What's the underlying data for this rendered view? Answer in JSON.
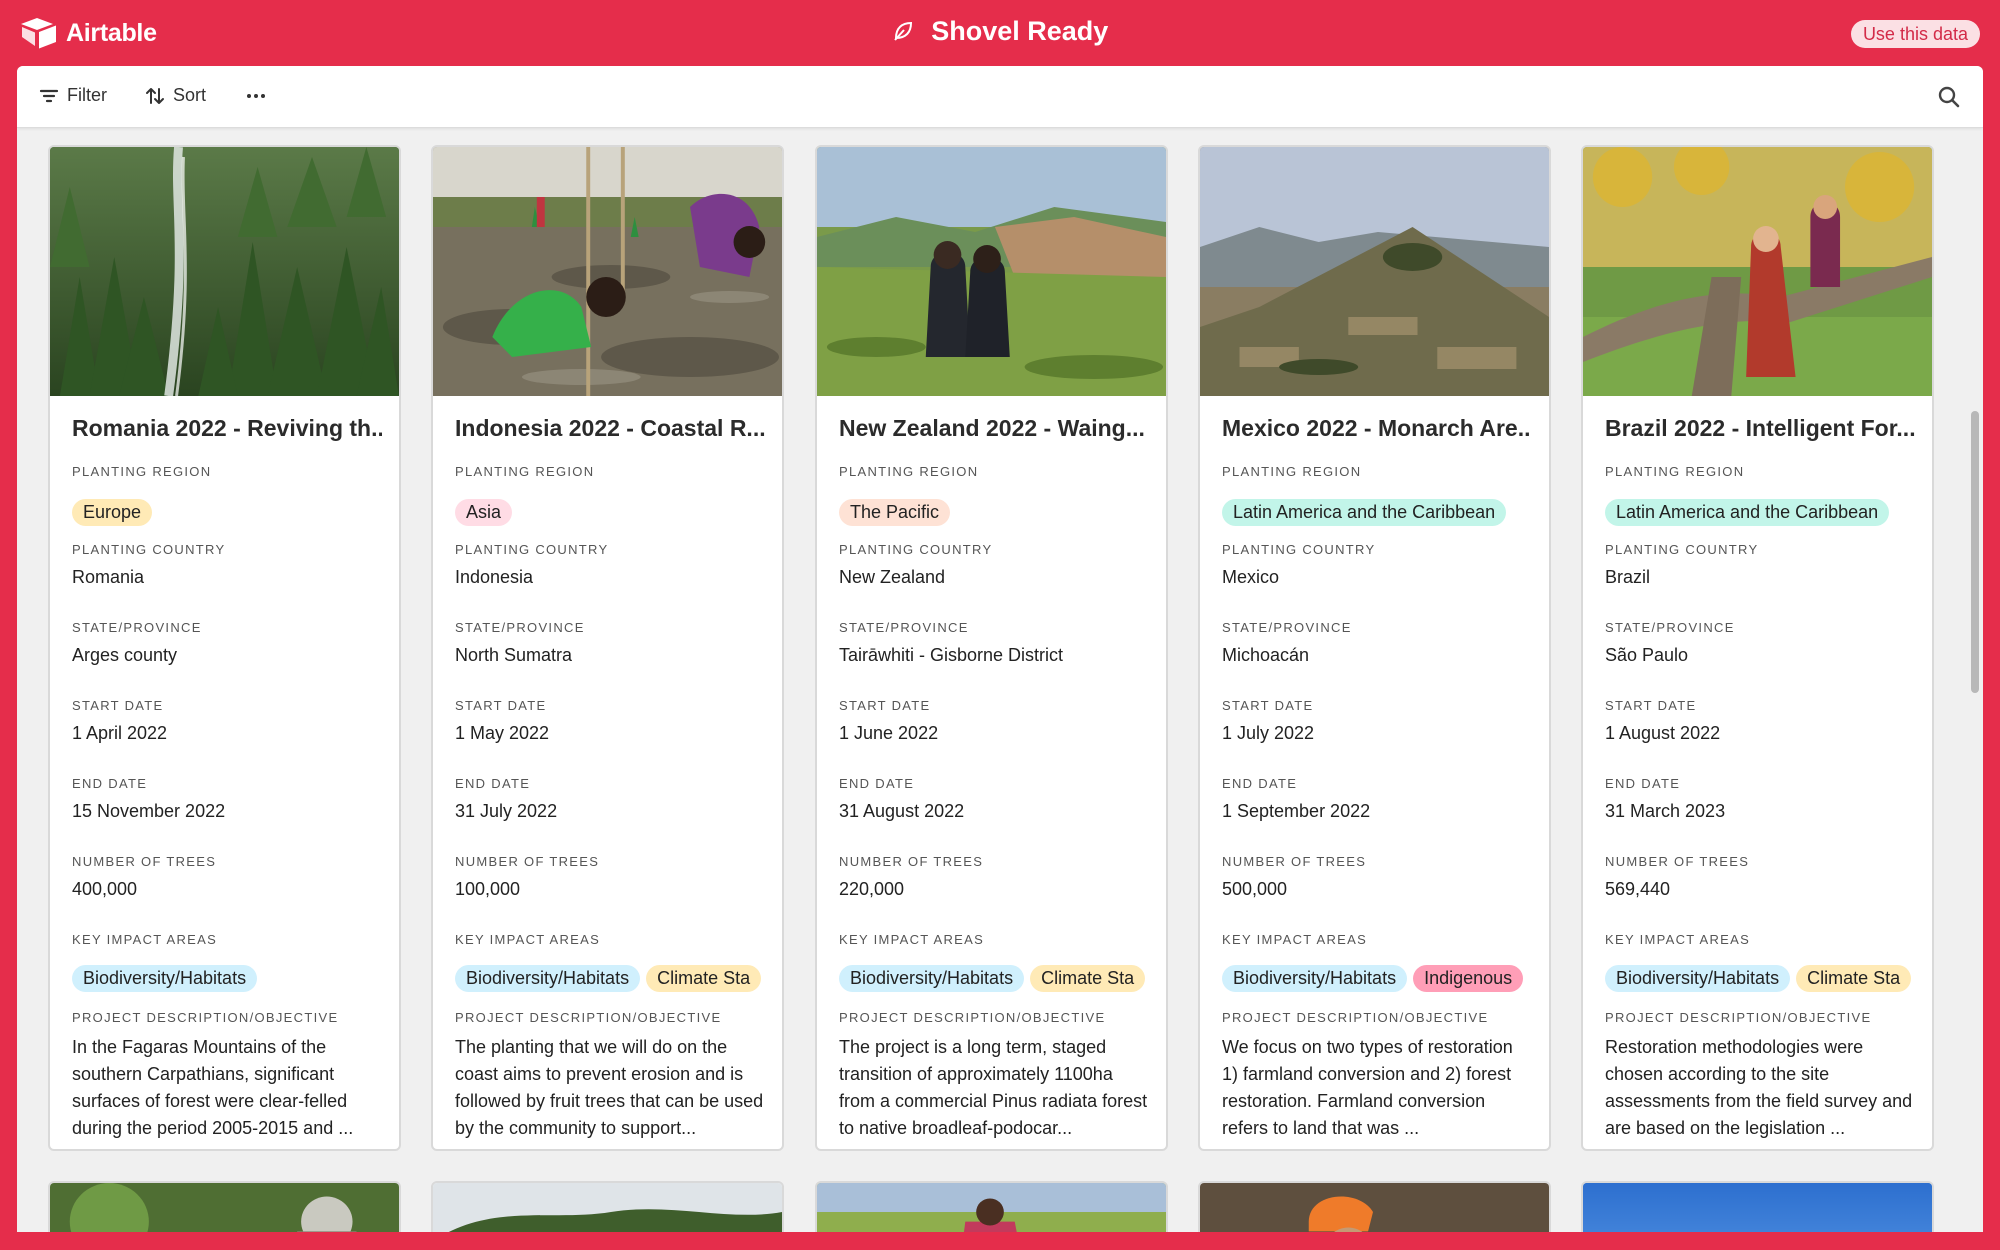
{
  "app": {
    "name": "Airtable",
    "base_title": "Shovel Ready",
    "use_data_label": "Use this data"
  },
  "toolbar": {
    "filter_label": "Filter",
    "sort_label": "Sort"
  },
  "labels": {
    "region": "PLANTING REGION",
    "country": "PLANTING COUNTRY",
    "state": "STATE/PROVINCE",
    "start": "START DATE",
    "end": "END DATE",
    "trees": "NUMBER OF TREES",
    "impact": "KEY IMPACT AREAS",
    "desc": "PROJECT DESCRIPTION/OBJECTIVE"
  },
  "colors": {
    "brand": "#e52d4b",
    "tag_europe": "#ffeab6",
    "tag_asia": "#ffdce5",
    "tag_pacific": "#fee2d5",
    "tag_latam": "#c2f5e9",
    "tag_bio": "#d0f0fd",
    "tag_climate": "#ffeab6",
    "tag_indigenous": "#ff9eb7"
  },
  "cards": [
    {
      "title": "Romania 2022 - Reviving th...",
      "region": "Europe",
      "country": "Romania",
      "state": "Arges county",
      "start": "1 April 2022",
      "end": "15 November 2022",
      "trees": "400,000",
      "impact": [
        "Biodiversity/Habitats"
      ],
      "desc": "In the Fagaras Mountains of the southern Carpathians, significant surfaces of forest were clear-felled during the period 2005-2015 and ..."
    },
    {
      "title": "Indonesia 2022 - Coastal R...",
      "region": "Asia",
      "country": "Indonesia",
      "state": "North Sumatra",
      "start": "1 May 2022",
      "end": "31 July 2022",
      "trees": "100,000",
      "impact": [
        "Biodiversity/Habitats",
        "Climate Sta"
      ],
      "desc": "The planting that we will do on the coast aims to prevent erosion and is followed by fruit trees that can be used by the community to support..."
    },
    {
      "title": "New Zealand 2022 - Waing...",
      "region": "The Pacific",
      "country": "New Zealand",
      "state": "Tairāwhiti - Gisborne District",
      "start": "1 June 2022",
      "end": "31 August 2022",
      "trees": "220,000",
      "impact": [
        "Biodiversity/Habitats",
        "Climate Sta"
      ],
      "desc": "The project is a long term, staged transition of approximately 1100ha from a commercial Pinus radiata forest to native broadleaf-podocar..."
    },
    {
      "title": "Mexico 2022 - Monarch Are...",
      "region": "Latin America and the Caribbean",
      "country": "Mexico",
      "state": "Michoacán",
      "start": "1 July 2022",
      "end": "1 September 2022",
      "trees": "500,000",
      "impact": [
        "Biodiversity/Habitats",
        "Indigenous"
      ],
      "desc": "We focus on two types of restoration 1) farmland conversion and 2) forest restoration. Farmland conversion refers to land that was ..."
    },
    {
      "title": "Brazil 2022 - Intelligent For...",
      "region": "Latin America and the Caribbean",
      "country": "Brazil",
      "state": "São Paulo",
      "start": "1 August 2022",
      "end": "31 March 2023",
      "trees": "569,440",
      "impact": [
        "Biodiversity/Habitats",
        "Climate Sta"
      ],
      "desc": "Restoration methodologies were chosen according to the site assessments from the field survey and are based on the legislation ..."
    }
  ]
}
